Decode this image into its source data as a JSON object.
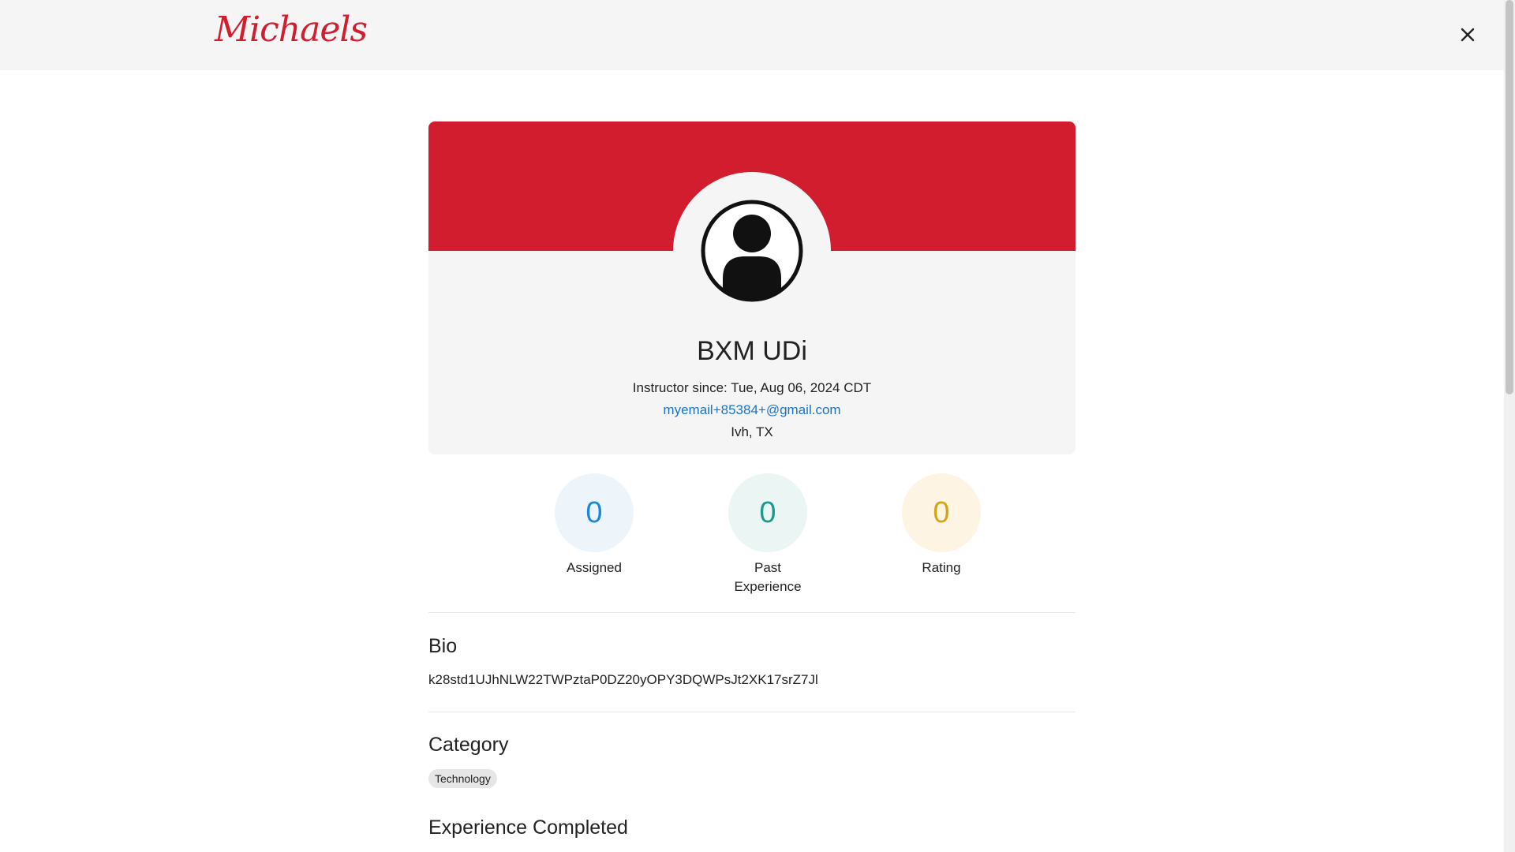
{
  "header": {
    "logo_text": "Michaels",
    "close_icon": "close-icon"
  },
  "colors": {
    "brand": "#d21d2f",
    "link": "#1a73c9",
    "assigned": "#1a8ad4",
    "past_experience": "#1e9a8c",
    "rating": "#d4a617"
  },
  "profile": {
    "name": "BXM UDi",
    "instructor_since": "Instructor since: Tue, Aug 06, 2024 CDT",
    "email": "myemail+85384+@gmail.com",
    "location": "Ivh, TX",
    "avatar_icon": "user-avatar-icon"
  },
  "stats": [
    {
      "value": "0",
      "label": "Assigned"
    },
    {
      "value": "0",
      "label": "Past Experience"
    },
    {
      "value": "0",
      "label": "Rating"
    }
  ],
  "bio": {
    "title": "Bio",
    "text": "k28std1UJhNLW22TWPztaP0DZ20yOPY3DQWPsJt2XK17srZ7Jl"
  },
  "category": {
    "title": "Category",
    "chips": [
      "Technology"
    ]
  },
  "experience": {
    "title": "Experience Completed"
  }
}
